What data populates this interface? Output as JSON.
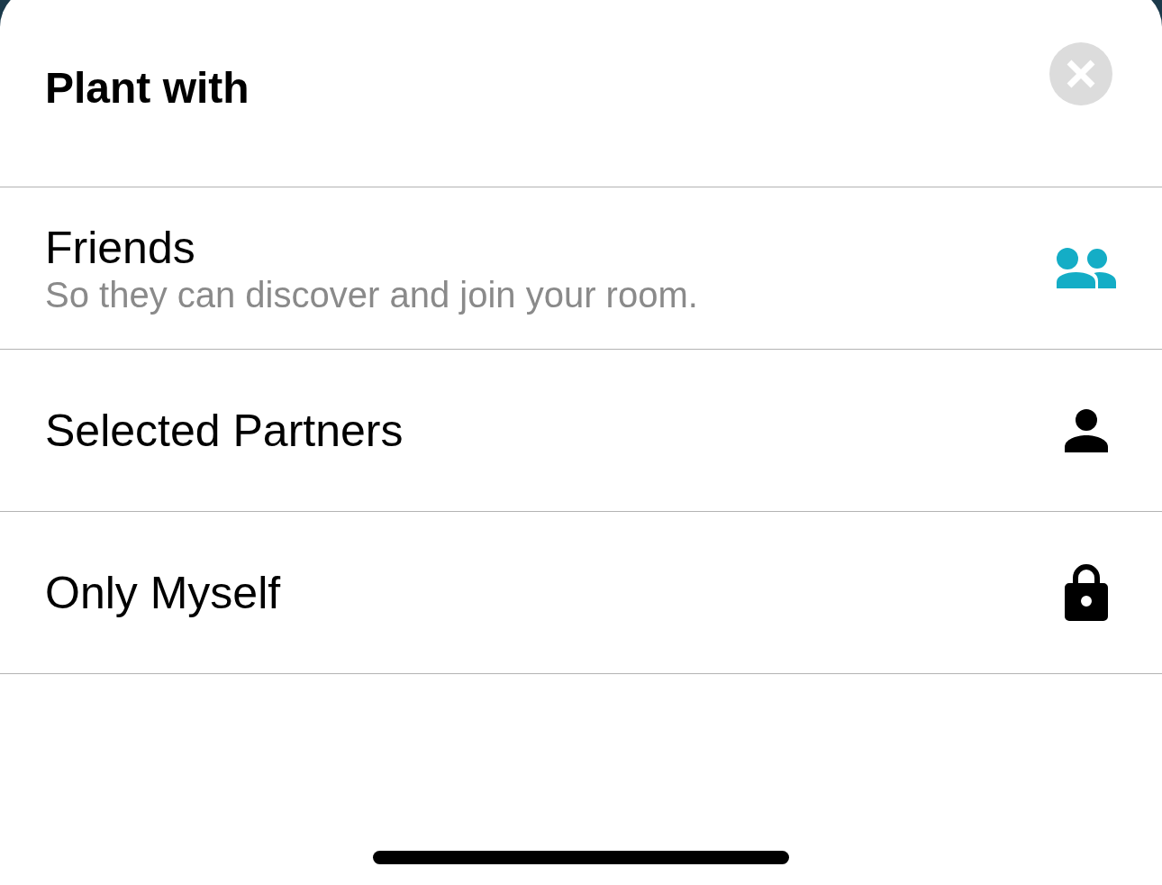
{
  "header": {
    "title": "Plant with"
  },
  "options": [
    {
      "kind": "friends",
      "label": "Friends",
      "description": "So they can discover and join your room.",
      "selected": true
    },
    {
      "kind": "partners",
      "label": "Selected Partners",
      "selected": false
    },
    {
      "kind": "private",
      "label": "Only Myself",
      "selected": false
    }
  ]
}
